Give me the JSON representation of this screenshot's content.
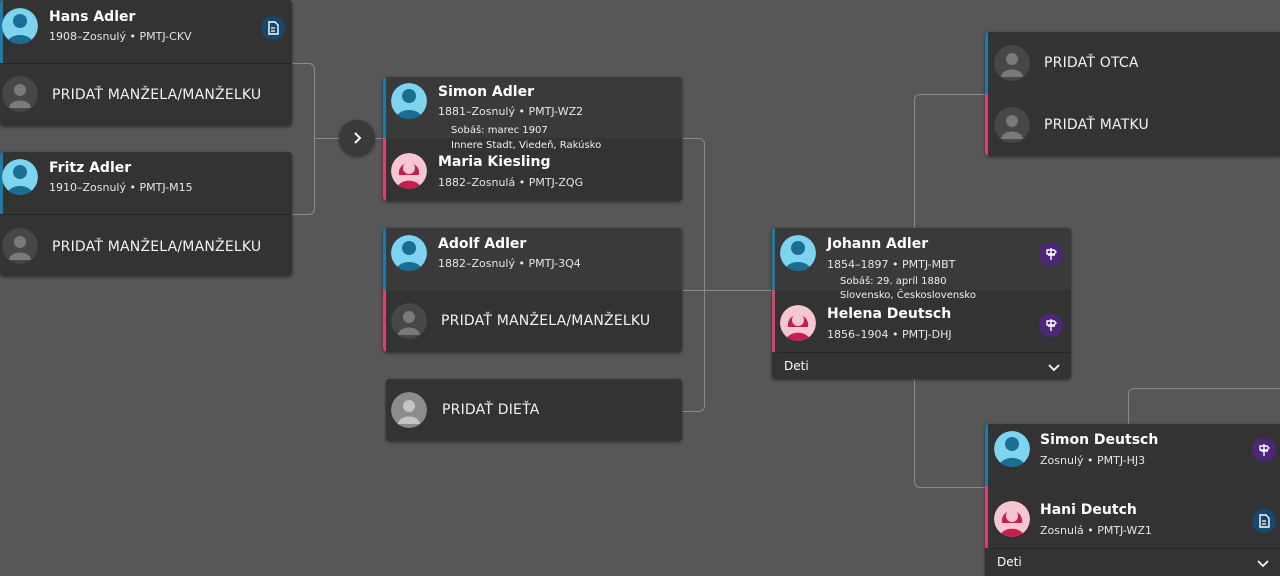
{
  "colors": {
    "male": "#1e7ba8",
    "female": "#d9416e",
    "background": "#575757",
    "card": "#333333"
  },
  "left_column": {
    "hans": {
      "name": "Hans Adler",
      "sub": "1908–Zosnulý • PMTJ-CKV",
      "icon": "document-icon"
    },
    "hans_add_spouse": "PRIDAŤ MANŽELA/MANŽELKU",
    "fritz": {
      "name": "Fritz Adler",
      "sub": "1910–Zosnulý • PMTJ-M15"
    },
    "fritz_add_spouse": "PRIDAŤ MANŽELA/MANŽELKU"
  },
  "middle_column": {
    "simon": {
      "name": "Simon Adler",
      "sub": "1881–Zosnulý • PMTJ-WZ2"
    },
    "simon_marriage": {
      "line1": "Sobáš: marec 1907",
      "line2": "Innere Stadt, Viedeň, Rakúsko"
    },
    "maria": {
      "name": "Maria Kiesling",
      "sub": "1882–Zosnulá • PMTJ-ZQG"
    },
    "adolf": {
      "name": "Adolf Adler",
      "sub": "1882–Zosnulý • PMTJ-3Q4"
    },
    "adolf_add_spouse": "PRIDAŤ MANŽELA/MANŽELKU",
    "add_child": "PRIDAŤ DIEŤA"
  },
  "focus": {
    "johann": {
      "name": "Johann Adler",
      "sub": "1854–1897 • PMTJ-MBT",
      "icon": "research-hint-icon"
    },
    "marriage": {
      "line1": "Sobáš: 29. apríl 1880",
      "line2": "Slovensko, Československo"
    },
    "helena": {
      "name": "Helena Deutsch",
      "sub": "1856–1904 • PMTJ-DHJ",
      "icon": "research-hint-icon"
    },
    "children_label": "Deti"
  },
  "right_column": {
    "add_father": "PRIDAŤ OTCA",
    "add_mother": "PRIDAŤ MATKU",
    "simon_deutsch": {
      "name": "Simon Deutsch",
      "sub": "Zosnulý • PMTJ-HJ3",
      "icon": "research-hint-icon"
    },
    "hani": {
      "name": "Hani Deutch",
      "sub": "Zosnulá • PMTJ-WZ1",
      "icon": "document-icon"
    },
    "children_label": "Deti"
  }
}
